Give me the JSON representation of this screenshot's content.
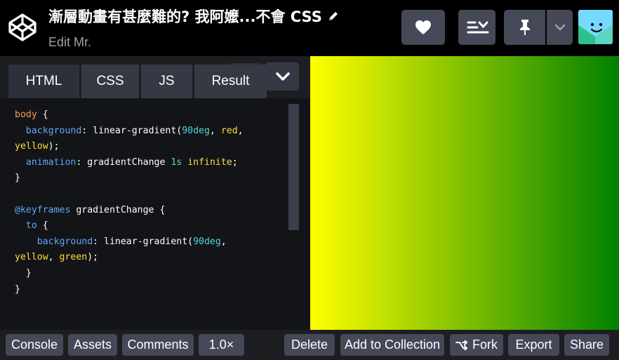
{
  "header": {
    "title": "漸層動畫有甚麼難的? 我阿嬤...不會 CSS",
    "subtitle": "Edit Mr.",
    "logo_icon": "codepen-cube-icon",
    "buttons": {
      "heart_icon": "heart-icon",
      "layout_icon": "layout-icon",
      "pin_icon": "pin-icon",
      "dropdown_icon": "chevron-down-icon"
    }
  },
  "editor": {
    "tabs": [
      "HTML",
      "CSS",
      "JS",
      "Result"
    ],
    "active_tab": "HTML",
    "code": {
      "l1_sel": "body",
      "l1_brace": " {",
      "l2_prop": "background",
      "l2_val": ": linear-gradient(",
      "l2_num": "90deg",
      "l2_comma": ", ",
      "l2_kw": "red",
      "l2_end": ",",
      "l3_kw": "yellow",
      "l3_end": ");",
      "l4_prop": "animation",
      "l4_val": ": gradientChange ",
      "l4_num": "1s",
      "l4_sp": " ",
      "l4_kw": "infinite",
      "l4_end": ";",
      "l5": "}",
      "l7_at": "@keyframes",
      "l7_name": " gradientChange {",
      "l8_kw": "to",
      "l8_brace": " {",
      "l9_prop": "background",
      "l9_val": ": linear-gradient(",
      "l9_num": "90deg",
      "l9_end": ",",
      "l10_kw1": "yellow",
      "l10_comma": ", ",
      "l10_kw2": "green",
      "l10_end": ");",
      "l11": "}",
      "l12": "}"
    }
  },
  "result": {
    "gradient_start": "#ffff00",
    "gradient_end": "#008000"
  },
  "footer": {
    "console": "Console",
    "assets": "Assets",
    "comments": "Comments",
    "zoom": "1.0×",
    "delete": "Delete",
    "add_to_collection": "Add to Collection",
    "fork": "Fork",
    "export": "Export",
    "share": "Share"
  },
  "colors": {
    "header_bg": "#000000",
    "button_bg": "#444857",
    "editor_bg": "#131417",
    "footer_bg": "#1d1e22"
  }
}
